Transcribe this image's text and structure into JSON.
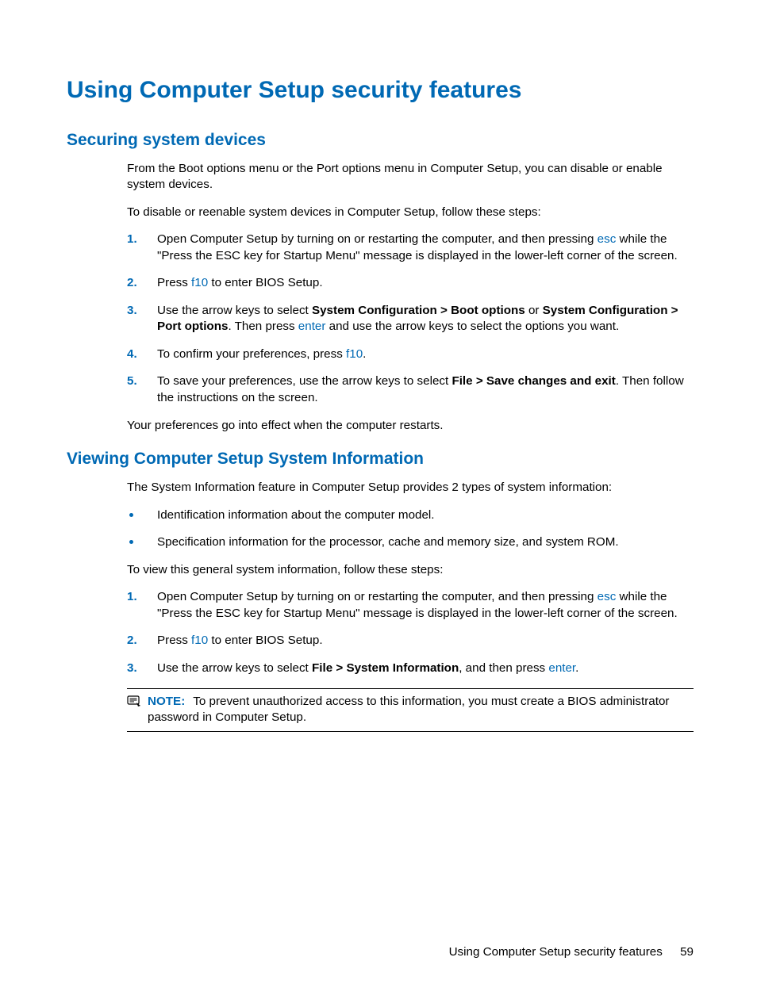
{
  "h1": "Using Computer Setup security features",
  "sec1": {
    "heading": "Securing system devices",
    "p1": "From the Boot options menu or the Port options menu in Computer Setup, you can disable or enable system devices.",
    "p2": "To disable or reenable system devices in Computer Setup, follow these steps:",
    "steps": {
      "n1": "1.",
      "s1a": "Open Computer Setup by turning on or restarting the computer, and then pressing ",
      "s1k": "esc",
      "s1b": " while the \"Press the ESC key for Startup Menu\" message is displayed in the lower-left corner of the screen.",
      "n2": "2.",
      "s2a": "Press ",
      "s2k": "f10",
      "s2b": " to enter BIOS Setup.",
      "n3": "3.",
      "s3a": "Use the arrow keys to select ",
      "s3b1": "System Configuration > Boot options",
      "s3mid": " or ",
      "s3b2": "System Configuration > Port options",
      "s3c": ". Then press ",
      "s3k": "enter",
      "s3d": " and use the arrow keys to select the options you want.",
      "n4": "4.",
      "s4a": "To confirm your preferences, press ",
      "s4k": "f10",
      "s4b": ".",
      "n5": "5.",
      "s5a": "To save your preferences, use the arrow keys to select ",
      "s5b": "File > Save changes and exit",
      "s5c": ". Then follow the instructions on the screen."
    },
    "p3": "Your preferences go into effect when the computer restarts."
  },
  "sec2": {
    "heading": "Viewing Computer Setup System Information",
    "p1": "The System Information feature in Computer Setup provides 2 types of system information:",
    "bullets": {
      "b1": "Identification information about the computer model.",
      "b2": "Specification information for the processor, cache and memory size, and system ROM."
    },
    "p2": "To view this general system information, follow these steps:",
    "steps": {
      "n1": "1.",
      "s1a": "Open Computer Setup by turning on or restarting the computer, and then pressing ",
      "s1k": "esc",
      "s1b": " while the \"Press the ESC key for Startup Menu\" message is displayed in the lower-left corner of the screen.",
      "n2": "2.",
      "s2a": "Press ",
      "s2k": "f10",
      "s2b": " to enter BIOS Setup.",
      "n3": "3.",
      "s3a": "Use the arrow keys to select ",
      "s3b": "File > System Information",
      "s3c": ", and then press ",
      "s3k": "enter",
      "s3d": "."
    },
    "note": {
      "label": "NOTE:",
      "text": "To prevent unauthorized access to this information, you must create a BIOS administrator password in Computer Setup."
    }
  },
  "footer": {
    "text": "Using Computer Setup security features",
    "page": "59"
  }
}
